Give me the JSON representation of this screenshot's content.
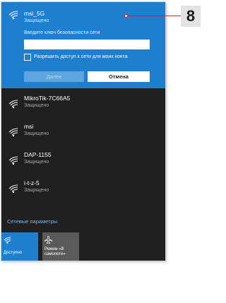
{
  "active_network": {
    "name": "msi_5G",
    "status": "Защищено",
    "key_label": "Введите ключ безопасности сети",
    "key_value": "",
    "share_label": "Разрешить доступ к сети для моих конта",
    "next_label": "Далее",
    "cancel_label": "Отмена"
  },
  "networks": [
    {
      "name": "MikroTik-7C66A5",
      "status": "Защищено"
    },
    {
      "name": "msi",
      "status": "Защищено"
    },
    {
      "name": "DAP-1155",
      "status": "Защищено"
    },
    {
      "name": "i-t-z-5",
      "status": "Защищено"
    }
  ],
  "settings_link": "Сетевые параметры",
  "tiles": {
    "wifi_label": "Доступно",
    "airplane_label_line1": "Режим «В",
    "airplane_label_line2": "самолете»"
  },
  "callout": {
    "number": "8"
  },
  "colors": {
    "accent": "#1e7fcf",
    "panel": "#202020",
    "callout_line": "#e31b23"
  },
  "icons": {
    "network": "wifi-icon",
    "airplane": "airplane-icon"
  }
}
